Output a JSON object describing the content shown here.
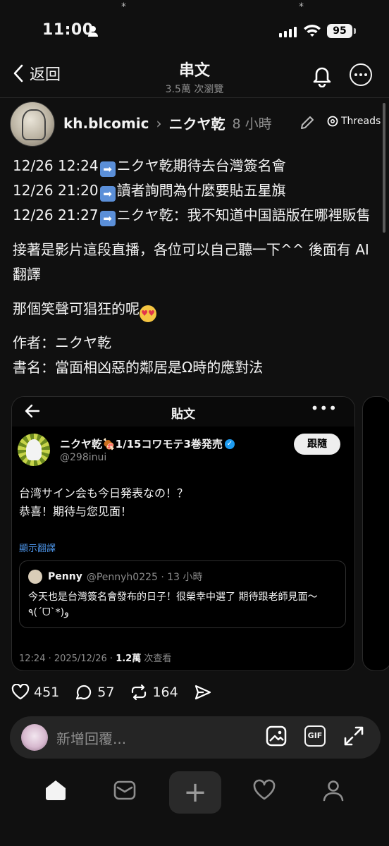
{
  "status": {
    "time": "11:00",
    "battery": "95"
  },
  "header": {
    "back": "返回",
    "title": "串文",
    "subtitle": "3.5萬 次瀏覽"
  },
  "post": {
    "author": "kh.blcomic",
    "coauthor": "ニクヤ乾",
    "time": "8 小時",
    "badge": "Threads",
    "lines": [
      {
        "date": "12/26 12:24",
        "text": "ニクヤ乾期待去台灣簽名會"
      },
      {
        "date": "12/26 21:20",
        "text": "讀者詢問為什麼要貼五星旗"
      },
      {
        "date": "12/26 21:27",
        "text": "ニクヤ乾：我不知道中国語版在哪裡販售"
      }
    ],
    "p2": "接著是影片這段直播，各位可以自己聽一下^^ 後面有 AI 翻譯",
    "p3": "那個笑聲可猖狂的呢",
    "p4a": "作者：ニクヤ乾",
    "p4b": "書名：當面相凶惡的鄰居是Ω時的應對法"
  },
  "embed": {
    "title": "貼文",
    "name": "ニクヤ乾🍖1/15コワモテ3巻発売",
    "handle": "@298inui",
    "follow": "跟隨",
    "text1": "台湾サイン会も今日発表なの！？",
    "text2": "恭喜！期待与您见面！",
    "translate": "顯示翻譯",
    "quote": {
      "name": "Penny",
      "meta": "@Pennyh0225 · 13 小時",
      "text": "今天也是台灣簽名會發布的日子！很榮幸中選了 期待跟老師見面～٩(ˊᗜˋ*)و"
    },
    "footer_time": "12:24 · 2025/12/26 · ",
    "footer_views": "1.2萬",
    "footer_suffix": " 次查看"
  },
  "actions": {
    "likes": "451",
    "replies": "57",
    "reposts": "164"
  },
  "reply": {
    "placeholder": "新增回覆..."
  },
  "colors": {
    "background": "#101010",
    "link": "#4a90e2",
    "verified": "#1d9bf0"
  }
}
